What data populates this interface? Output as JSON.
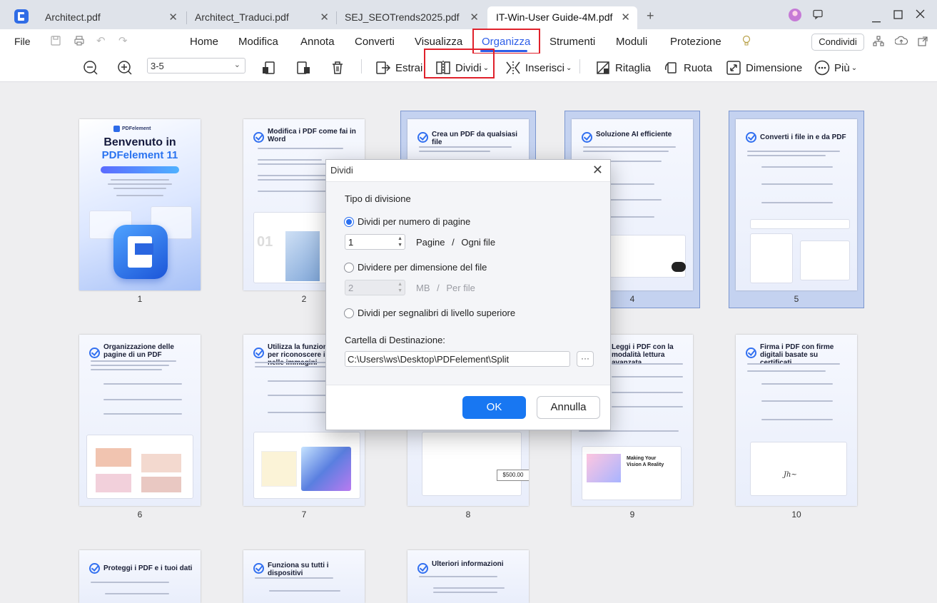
{
  "tabs": [
    {
      "label": "Architect.pdf"
    },
    {
      "label": "Architect_Traduci.pdf"
    },
    {
      "label": "SEJ_SEOTrends2025.pdf"
    },
    {
      "label": "IT-Win-User Guide-4M.pdf"
    }
  ],
  "menu": {
    "file": "File",
    "items": [
      "Home",
      "Modifica",
      "Annota",
      "Converti",
      "Visualizza",
      "Organizza",
      "Strumenti",
      "Moduli",
      "Protezione"
    ],
    "active": "Organizza",
    "share": "Condividi"
  },
  "toolbar": {
    "page_range": "3-5",
    "extract": "Estrai",
    "split": "Dividi",
    "insert": "Inserisci",
    "crop": "Ritaglia",
    "rotate": "Ruota",
    "size": "Dimensione",
    "more": "Più"
  },
  "pages": [
    {
      "num": "1",
      "title": "Benvenuto in PDFelement 11",
      "brand": "PDFelement",
      "selected": false
    },
    {
      "num": "2",
      "title": "Modifica i PDF come fai in Word",
      "selected": false
    },
    {
      "num": "3",
      "title": "Crea un PDF da qualsiasi file",
      "selected": true
    },
    {
      "num": "4",
      "title": "Soluzione AI efficiente",
      "selected": true
    },
    {
      "num": "5",
      "title": "Converti i file in e da PDF",
      "selected": true
    },
    {
      "num": "6",
      "title": "Organizzazione delle pagine di un PDF",
      "selected": false
    },
    {
      "num": "7",
      "title": "Utilizza la funzione OCR per riconoscere il testo nelle immagini",
      "selected": false
    },
    {
      "num": "8",
      "title": "",
      "selected": false
    },
    {
      "num": "9",
      "title": "Leggi i PDF con la modalità lettura avanzata",
      "selected": false
    },
    {
      "num": "10",
      "title": "Firma i PDF con firme digitali basate su certificati",
      "selected": false
    },
    {
      "num": "",
      "title": "Proteggi i PDF e i tuoi dati",
      "selected": false
    },
    {
      "num": "",
      "title": "Funziona su tutti i dispositivi",
      "selected": false
    },
    {
      "num": "",
      "title": "Ulteriori informazioni",
      "selected": false
    }
  ],
  "dialog": {
    "title": "Dividi",
    "section_type": "Tipo di divisione",
    "opt_pages": "Dividi per numero di pagine",
    "pages_value": "1",
    "pages_unit": "Pagine",
    "pages_sep": "/",
    "pages_suffix": "Ogni file",
    "opt_size": "Dividere per dimensione del file",
    "size_value": "2",
    "size_unit": "MB",
    "size_sep": "/",
    "size_suffix": "Per file",
    "opt_bookmarks": "Dividi per segnalibri di livello superiore",
    "dest_label": "Cartella di Destinazione:",
    "dest_path": "C:\\Users\\ws\\Desktop\\PDFelement\\Split",
    "browse": "···",
    "ok": "OK",
    "cancel": "Annulla"
  },
  "colors": {
    "accent": "#2d5ee8",
    "primary_button": "#1877f2",
    "highlight": "#e0212b",
    "selection": "#c4d2f0"
  }
}
